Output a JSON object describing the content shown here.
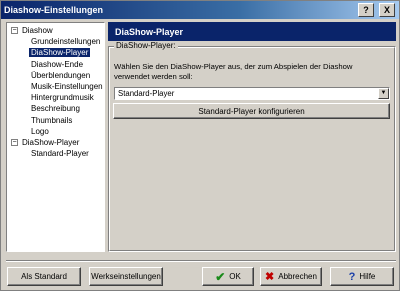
{
  "window": {
    "title": "Diashow-Einstellungen"
  },
  "titlebar_buttons": {
    "help_icon": "help-icon",
    "close_glyph": "X"
  },
  "tree": {
    "root1": {
      "label": "Diashow",
      "toggle": "−"
    },
    "root1_children": [
      "Grundeinstellungen",
      "DiaShow-Player",
      "Diashow-Ende",
      "Überblendungen",
      "Musik-Einstellungen",
      "Hintergrundmusik",
      "Beschreibung",
      "Thumbnails",
      "Logo"
    ],
    "selected": "DiaShow-Player",
    "root2": {
      "label": "DiaShow-Player",
      "toggle": "−"
    },
    "root2_children": [
      "Standard-Player"
    ]
  },
  "panel": {
    "title": "DiaShow-Player",
    "group_label": "DiaShow-Player:",
    "description": "Wählen Sie den DiaShow-Player aus, der zum Abspielen der Diashow verwendet werden soll:",
    "player_select": {
      "value": "Standard-Player"
    },
    "configure_button": "Standard-Player konfigurieren"
  },
  "footer": {
    "as_default": "Als Standard",
    "factory_settings": "Werkseinstellungen",
    "ok": "OK",
    "cancel": "Abbrechen",
    "help": "Hilfe"
  }
}
